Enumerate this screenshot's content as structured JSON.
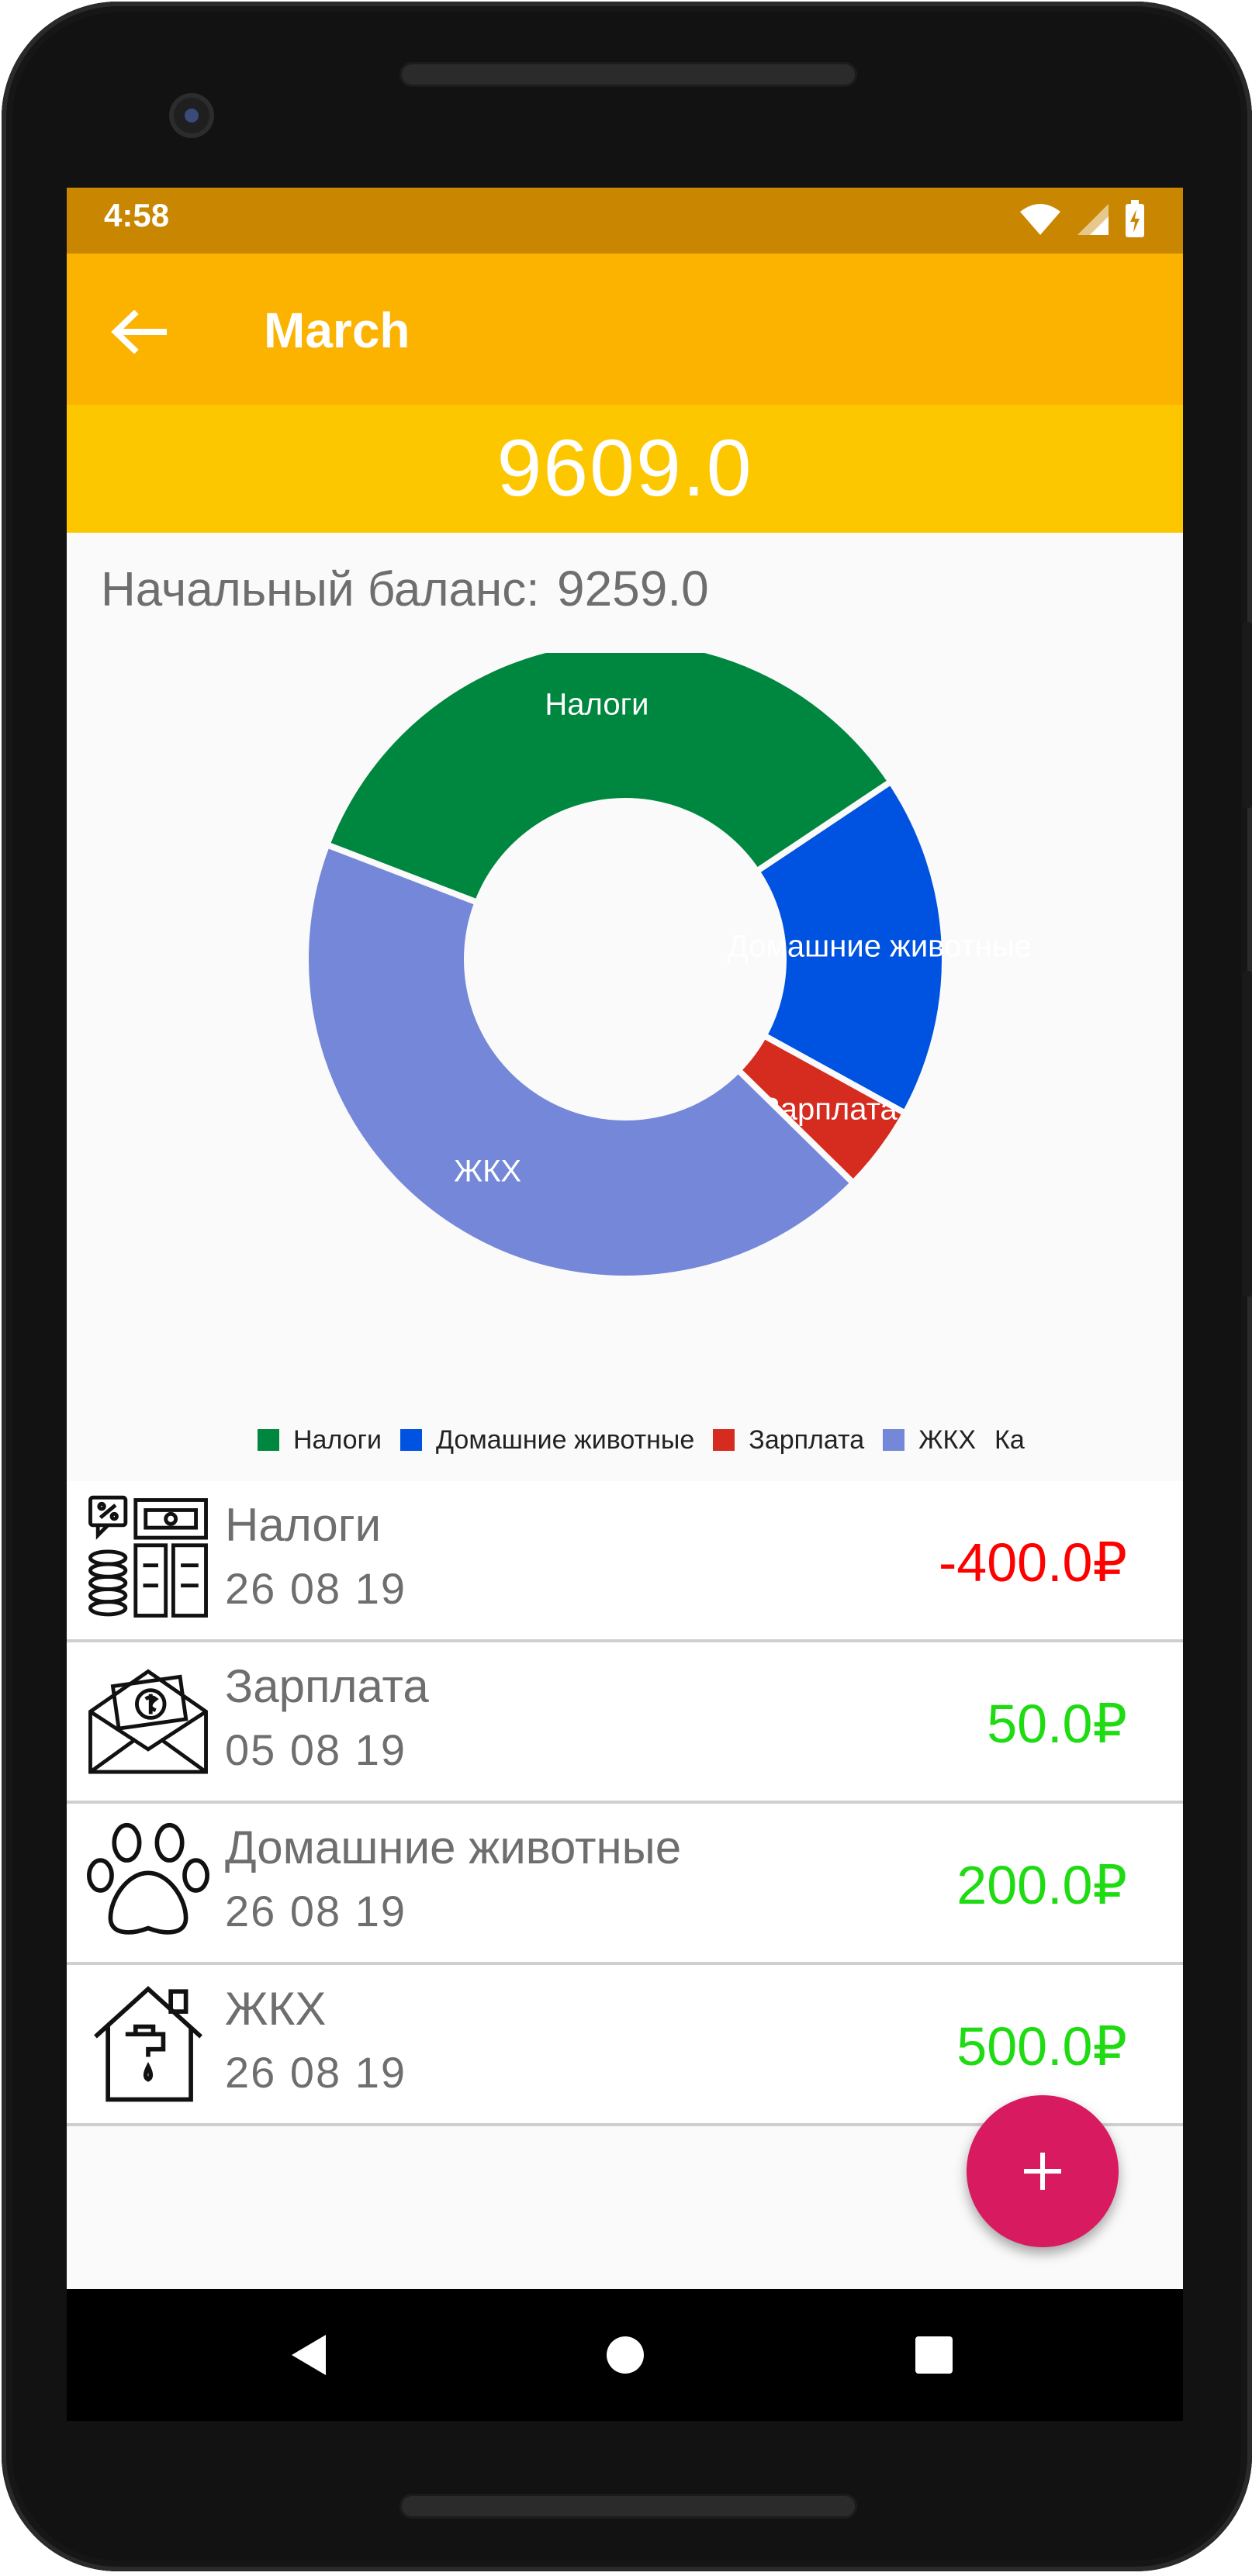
{
  "status_bar": {
    "time": "4:58",
    "icons": [
      "wifi-icon",
      "signal-icon",
      "battery-charging-icon"
    ]
  },
  "app_bar": {
    "back_icon": "arrow-left-icon",
    "title": "March"
  },
  "balance": {
    "current": "9609.0",
    "start_label": "Начальный баланс:",
    "start_value": "9259.0"
  },
  "chart_data": {
    "type": "pie",
    "donut": true,
    "categories": [
      "Налоги",
      "Домашние животные",
      "Зарплата",
      "ЖКХ"
    ],
    "values": [
      400,
      200,
      50,
      500
    ],
    "colors": [
      "#00873f",
      "#0052e0",
      "#d62b1f",
      "#7587d8"
    ],
    "slice_labels": [
      "Налоги",
      "Домашние животные",
      "Зарплата",
      "ЖКХ"
    ],
    "legend": [
      "Налоги",
      "Домашние животные",
      "Зарплата",
      "ЖКХ",
      "Ка"
    ],
    "legend_placement": "bottom"
  },
  "transactions": [
    {
      "name": "Налоги",
      "date": "26 08 19",
      "amount": "-400.0₽",
      "color": "#ff0000",
      "icon": "taxes-icon"
    },
    {
      "name": "Зарплата",
      "date": "05 08 19",
      "amount": "50.0₽",
      "color": "#1edb12",
      "icon": "salary-envelope-icon"
    },
    {
      "name": "Домашние животные",
      "date": "26 08 19",
      "amount": "200.0₽",
      "color": "#1edb12",
      "icon": "paw-icon"
    },
    {
      "name": "ЖКХ",
      "date": "26 08 19",
      "amount": "500.0₽",
      "color": "#1edb12",
      "icon": "house-faucet-icon"
    }
  ],
  "fab": {
    "icon": "plus-icon"
  },
  "nav": {
    "back": "nav-back-icon",
    "home": "nav-home-icon",
    "recents": "nav-recents-icon"
  },
  "colors": {
    "status_bar": "#c98600",
    "app_bar": "#fbb300",
    "balance_bar": "#fdc700",
    "fab": "#d81b60"
  }
}
